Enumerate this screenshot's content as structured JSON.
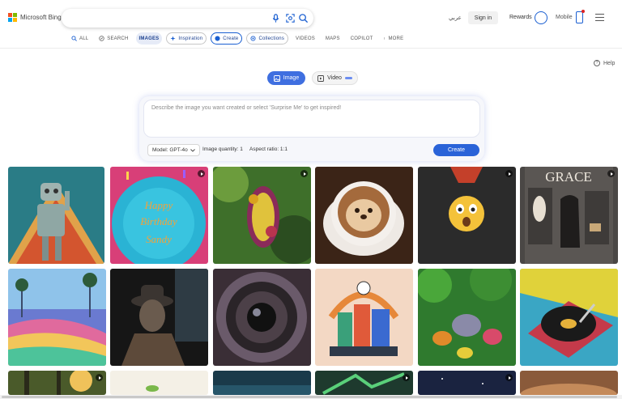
{
  "header": {
    "brand": "Microsoft Bing",
    "search_value": "",
    "language": "عربي",
    "signin_label": "Sign in",
    "rewards_label": "Rewards",
    "mobile_label": "Mobile"
  },
  "scopes": [
    {
      "label": "ALL",
      "icon": "search-icon"
    },
    {
      "label": "SEARCH",
      "icon": "copilot-icon"
    },
    {
      "label": "IMAGES",
      "icon": ""
    },
    {
      "label": "Inspiration",
      "icon": "sparkle-icon"
    },
    {
      "label": "Create",
      "icon": "create-icon"
    },
    {
      "label": "Collections",
      "icon": "collections-icon"
    },
    {
      "label": "VIDEOS",
      "icon": ""
    },
    {
      "label": "MAPS",
      "icon": ""
    },
    {
      "label": "COPILOT",
      "icon": ""
    },
    {
      "label": "MORE",
      "icon": "more-vertical-icon"
    }
  ],
  "help_label": "Help",
  "mode": {
    "image_label": "Image",
    "video_label": "Video"
  },
  "prompt": {
    "placeholder": "Describe the image you want created or select 'Surprise Me' to get inspired!",
    "model_label": "Model: GPT-4o",
    "quantity_label": "Image quantity: 1",
    "ratio_label": "Aspect ratio: 1:1",
    "create_label": "Create"
  },
  "gallery": [
    {
      "name": "robot-pop-art",
      "video": false
    },
    {
      "name": "happy-birthday-sandy-cake",
      "video": true,
      "text": "Happy Birthday Sandy"
    },
    {
      "name": "flower-bee-macro",
      "video": true
    },
    {
      "name": "otter-latte-art",
      "video": false
    },
    {
      "name": "surprised-emoji",
      "video": true
    },
    {
      "name": "grace-dog-locker",
      "video": true,
      "text": "GRACE"
    },
    {
      "name": "rainbow-palm-landscape",
      "video": false
    },
    {
      "name": "detective-dog",
      "video": false
    },
    {
      "name": "camera-lens-closeup",
      "video": false
    },
    {
      "name": "isometric-city-clock",
      "video": false
    },
    {
      "name": "jungle-animals",
      "video": false
    },
    {
      "name": "pop-art-turntable",
      "video": false
    }
  ],
  "colors": {
    "accent": "#2a63d8",
    "image_toggle": "#3f6fe0"
  }
}
